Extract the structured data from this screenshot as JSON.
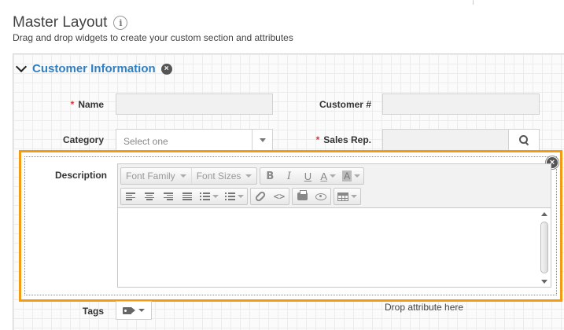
{
  "header": {
    "title": "Master Layout",
    "info_icon": "i",
    "subtitle": "Drag and drop widgets to create your custom section and attributes"
  },
  "section": {
    "title": "Customer Information",
    "remove_icon": "×"
  },
  "fields": {
    "required_marker": "*",
    "name": {
      "label": "Name",
      "value": ""
    },
    "customer_number": {
      "label": "Customer #",
      "value": ""
    },
    "category": {
      "label": "Category",
      "selected": "Select one"
    },
    "sales_rep": {
      "label": "Sales Rep.",
      "value": ""
    },
    "description": {
      "label": "Description",
      "remove_icon": "×"
    },
    "tags": {
      "label": "Tags"
    }
  },
  "editor": {
    "font_family": "Font Family",
    "font_sizes": "Font Sizes",
    "bold": "B",
    "italic": "I",
    "underline": "U",
    "font_color": "A",
    "bg_color": "A",
    "code": "<>"
  },
  "drop_hint": "Drop attribute here",
  "colors": {
    "section_title": "#2f7fc1",
    "highlight_border": "#f39c12",
    "required": "#d33333"
  }
}
